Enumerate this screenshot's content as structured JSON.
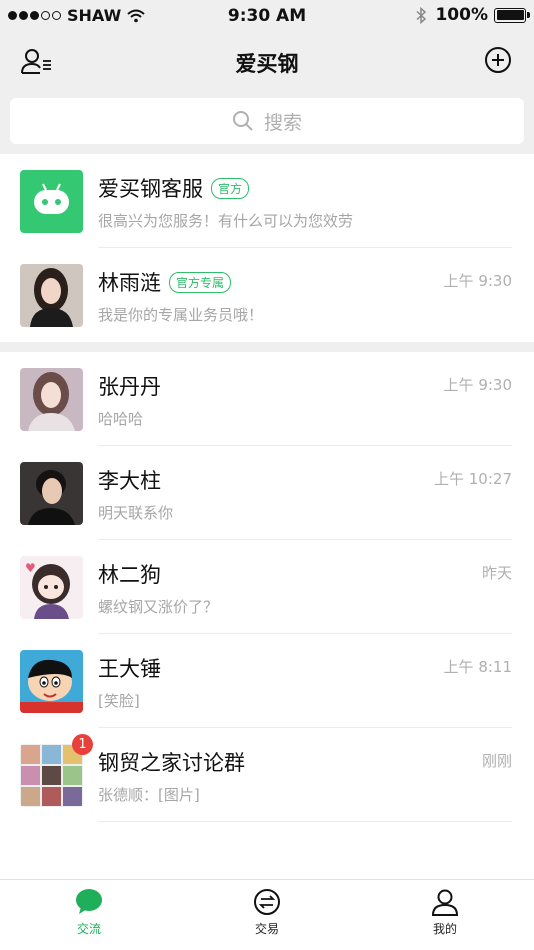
{
  "status_bar": {
    "carrier": "SHAW",
    "time": "9:30 AM",
    "battery": "100%"
  },
  "nav": {
    "title": "爱买钢",
    "left_icon": "contacts-icon",
    "right_icon": "add-circle-icon"
  },
  "search": {
    "placeholder": "搜索"
  },
  "pinned": [
    {
      "name": "爱买钢客服",
      "tag": "官方",
      "message": "很高兴为您服务！有什么可以为您效劳",
      "time": "",
      "avatar": "robot-avatar"
    },
    {
      "name": "林雨涟",
      "tag": "官方专属",
      "message": "我是你的专属业务员哦！",
      "time": "上午 9:30",
      "avatar": "woman-avatar"
    }
  ],
  "chats": [
    {
      "name": "张丹丹",
      "message": "哈哈哈",
      "time": "上午 9:30",
      "avatar": "woman-avatar"
    },
    {
      "name": "李大柱",
      "message": "明天联系你",
      "time": "上午 10:27",
      "avatar": "man-avatar"
    },
    {
      "name": "林二狗",
      "message": "螺纹钢又涨价了？",
      "time": "昨天",
      "avatar": "cartoon-girl-avatar"
    },
    {
      "name": "王大锤",
      "message": "[笑脸]",
      "time": "上午 8:11",
      "avatar": "cartoon-boy-avatar"
    },
    {
      "name": "钢贸之家讨论群",
      "message": "张德顺：[图片]",
      "time": "刚刚",
      "avatar": "group-avatar",
      "badge": "1"
    }
  ],
  "tabs": [
    {
      "label": "交流",
      "icon": "chat-bubble-icon",
      "active": true
    },
    {
      "label": "交易",
      "icon": "exchange-icon",
      "active": false
    },
    {
      "label": "我的",
      "icon": "person-icon",
      "active": false
    }
  ],
  "colors": {
    "accent": "#1fae5a",
    "tag_green": "#2ebd6b",
    "badge_red": "#e8413b",
    "header_bg": "#efefef"
  }
}
